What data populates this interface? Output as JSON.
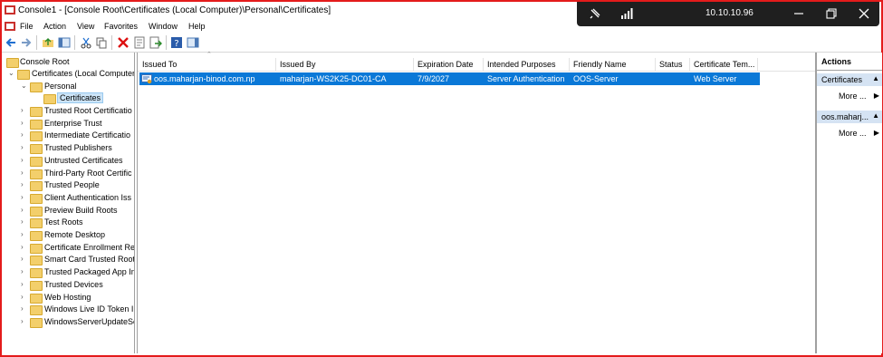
{
  "window": {
    "title": "Console1 - [Console Root\\Certificates (Local Computer)\\Personal\\Certificates]"
  },
  "rdp": {
    "ip": "10.10.10.96"
  },
  "menu": [
    "File",
    "Action",
    "View",
    "Favorites",
    "Window",
    "Help"
  ],
  "tree": {
    "root": "Console Root",
    "certs": "Certificates (Local Computer",
    "personal": "Personal",
    "certificates": "Certificates",
    "stores": [
      "Trusted Root Certificatio",
      "Enterprise Trust",
      "Intermediate Certificatio",
      "Trusted Publishers",
      "Untrusted Certificates",
      "Third-Party Root Certific",
      "Trusted People",
      "Client Authentication Iss",
      "Preview Build Roots",
      "Test Roots",
      "Remote Desktop",
      "Certificate Enrollment Re",
      "Smart Card Trusted Root",
      "Trusted Packaged App In",
      "Trusted Devices",
      "Web Hosting",
      "Windows Live ID Token I",
      "WindowsServerUpdateSe"
    ]
  },
  "list": {
    "columns": [
      "Issued To",
      "Issued By",
      "Expiration Date",
      "Intended Purposes",
      "Friendly Name",
      "Status",
      "Certificate Tem..."
    ],
    "rows": [
      [
        "oos.maharjan-binod.com.np",
        "maharjan-WS2K25-DC01-CA",
        "7/9/2027",
        "Server Authentication",
        "OOS-Server",
        "",
        "Web Server"
      ]
    ]
  },
  "actions": {
    "title": "Actions",
    "section1": "Certificates",
    "more1": "More ...",
    "section2": "oos.maharj...",
    "more2": "More ..."
  },
  "colors": {
    "selection": "#0a78d7",
    "frame": "#e41b1b"
  }
}
